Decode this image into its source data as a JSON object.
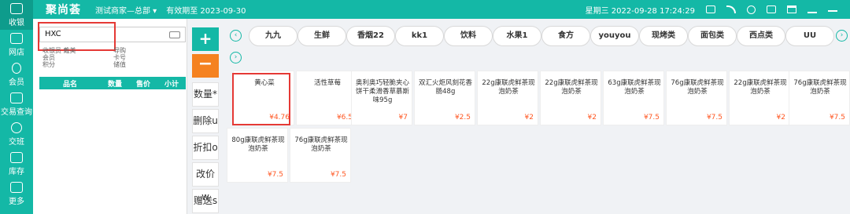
{
  "sidebar": {
    "items": [
      {
        "label": "收银",
        "icon": "cash-register-icon"
      },
      {
        "label": "网店",
        "icon": "store-icon"
      },
      {
        "label": "会员",
        "icon": "member-icon"
      },
      {
        "label": "交易查询",
        "icon": "transaction-icon"
      },
      {
        "label": "交班",
        "icon": "shift-icon"
      },
      {
        "label": "库存",
        "icon": "inventory-icon"
      },
      {
        "label": "更多",
        "icon": "grid-icon"
      }
    ]
  },
  "topbar": {
    "brand": "聚尚荟",
    "merchant": "测试商家—总部 ▾",
    "expiry": "有效期至 2023-09-30",
    "datetime": "星期三 2022-09-28 17:24:29"
  },
  "search": {
    "value": "HXC"
  },
  "member_info": {
    "cashier_label": "收银员",
    "cashier_value": "戴美",
    "guide_label": "导购",
    "member_label": "会员",
    "card_label": "卡号",
    "points_label": "积分",
    "stored_label": "储值"
  },
  "cart": {
    "columns": [
      "品名",
      "数量",
      "售价",
      "小计"
    ]
  },
  "ops": {
    "plus": "+",
    "minus": "−",
    "buttons": [
      "数量*",
      "删除u",
      "折扣o",
      "改价w",
      "赠送s"
    ]
  },
  "categories": [
    "九九",
    "生鲜",
    "香烟22",
    "kk1",
    "饮料",
    "水果1",
    "食方",
    "youyou",
    "现烤类",
    "面包类",
    "西点类",
    "UU"
  ],
  "products": [
    {
      "name": "黄心菜",
      "price": "¥4.76"
    },
    {
      "name": "活性草莓",
      "price": "¥6.5"
    },
    {
      "name": "奥利奥巧轻脆夹心饼干柔滑香草慕斯味95g",
      "price": "¥7"
    },
    {
      "name": "双汇火炬风刻花香肠48g",
      "price": "¥2.5"
    },
    {
      "name": "22g康联虎鲜茶现泡奶茶",
      "price": "¥2"
    },
    {
      "name": "22g康联虎鲜茶现泡奶茶",
      "price": "¥2"
    },
    {
      "name": "63g康联虎鲜茶现泡奶茶",
      "price": "¥7.5"
    },
    {
      "name": "76g康联虎鲜茶现泡奶茶",
      "price": "¥7.5"
    },
    {
      "name": "22g康联虎鲜茶现泡奶茶",
      "price": "¥2"
    },
    {
      "name": "76g康联虎鲜茶现泡奶茶",
      "price": "¥7.5"
    },
    {
      "name": "80g康联虎鲜茶现泡奶茶",
      "price": "¥7.5"
    },
    {
      "name": "76g康联虎鲜茶现泡奶茶",
      "price": "¥7.5"
    }
  ],
  "colors": {
    "primary": "#14b8a6",
    "accent": "#f58220",
    "highlight": "#e53935",
    "price": "#ff5722"
  }
}
